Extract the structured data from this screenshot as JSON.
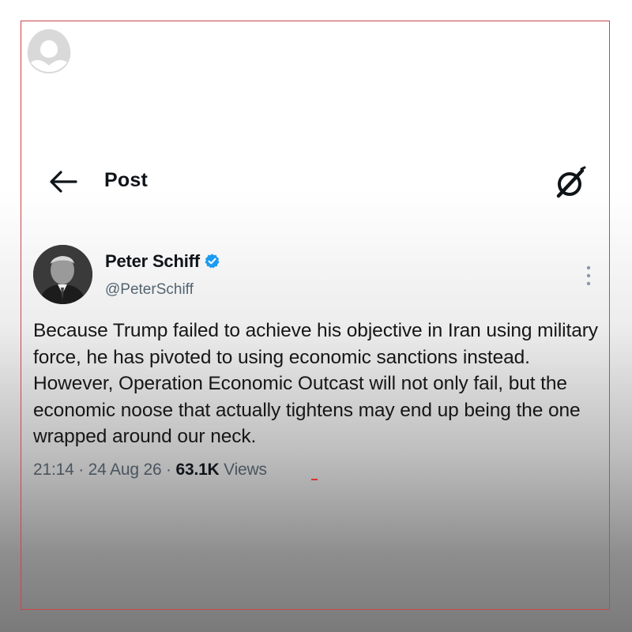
{
  "header": {
    "title": "Post",
    "back_icon": "arrow-left-icon",
    "grok_icon": "grok-icon"
  },
  "post": {
    "author_name": "Peter Schiff",
    "author_handle": "@PeterSchiff",
    "verified": true,
    "text": "Because Trump failed to achieve his objective in Iran using military force, he has pivoted to using economic sanctions instead. However, Operation Economic Outcast will not only fail, but the economic noose that actually tightens may end up being the one wrapped around our neck.",
    "time": "21:14",
    "separator": " · ",
    "date": "24 Aug 26",
    "views_count": "63.1K",
    "views_label": " Views"
  },
  "colors": {
    "verified_blue": "#1d9bf0",
    "frame_red": "#c9464e",
    "text_primary": "#0f1419",
    "text_secondary": "#536471"
  }
}
